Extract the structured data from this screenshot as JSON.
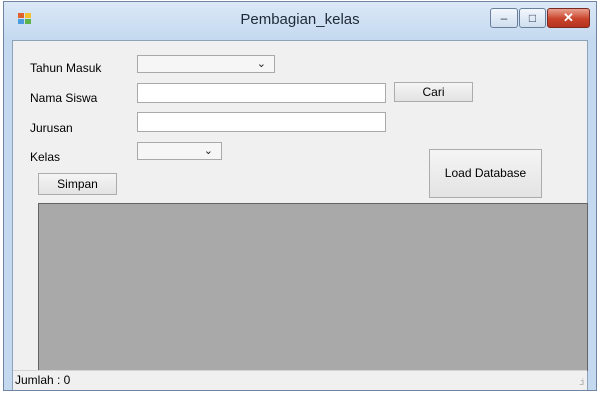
{
  "window": {
    "title": "Pembagian_kelas"
  },
  "controls": {
    "minimize": "–",
    "maximize": "□",
    "close": "✕"
  },
  "form": {
    "tahun_masuk_label": "Tahun Masuk",
    "tahun_masuk_value": "",
    "nama_siswa_label": "Nama Siswa",
    "nama_siswa_value": "",
    "cari_label": "Cari",
    "jurusan_label": "Jurusan",
    "jurusan_value": "",
    "kelas_label": "Kelas",
    "kelas_value": "",
    "simpan_label": "Simpan",
    "load_database_label": "Load Database"
  },
  "status": {
    "jumlah_text": "Jumlah :  0"
  },
  "icons": {
    "dropdown": "chevron-down-icon",
    "app": "app-icon",
    "grip": "resize-grip-icon"
  },
  "colors": {
    "grid_background": "#a9a9a9",
    "close_button": "#c8432b",
    "title_bar": "#c4d9ef"
  }
}
